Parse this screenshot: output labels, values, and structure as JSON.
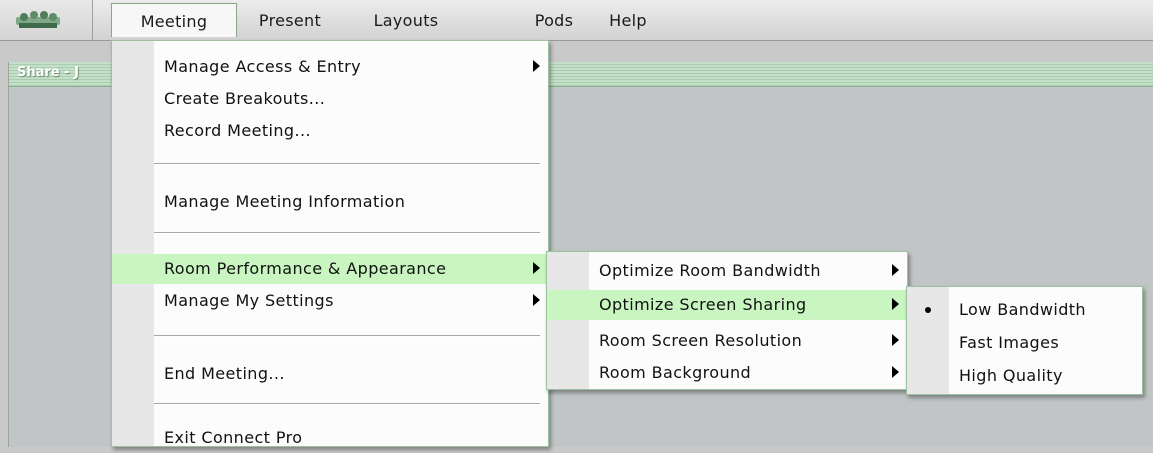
{
  "menubar": {
    "logo_icon": "connect-pro-logo-icon",
    "items": [
      {
        "label": "Meeting"
      },
      {
        "label": "Present"
      },
      {
        "label": "Layouts"
      },
      {
        "label": "Pods"
      },
      {
        "label": "Help"
      }
    ]
  },
  "pod": {
    "title": "Share - J"
  },
  "meeting_menu": {
    "items": [
      {
        "label": "Manage Access & Entry",
        "has_submenu": true
      },
      {
        "label": "Create Breakouts..."
      },
      {
        "label": "Record Meeting..."
      },
      {
        "label": "Manage Meeting Information"
      },
      {
        "label": "Room Performance & Appearance",
        "has_submenu": true,
        "highlighted": true
      },
      {
        "label": "Manage My Settings",
        "has_submenu": true
      },
      {
        "label": "End Meeting..."
      },
      {
        "label": "Exit Connect Pro"
      }
    ]
  },
  "performance_menu": {
    "items": [
      {
        "label": "Optimize Room Bandwidth",
        "has_submenu": true
      },
      {
        "label": "Optimize Screen Sharing",
        "has_submenu": true,
        "highlighted": true
      },
      {
        "label": "Room Screen Resolution",
        "has_submenu": true
      },
      {
        "label": "Room Background",
        "has_submenu": true
      }
    ]
  },
  "screen_sharing_menu": {
    "items": [
      {
        "label": "Low Bandwidth",
        "selected": true
      },
      {
        "label": "Fast Images"
      },
      {
        "label": "High Quality"
      }
    ]
  },
  "colors": {
    "highlight": "#c8f5c0",
    "menu_border": "#9bc19e",
    "pod_title": "#a9cdb0"
  }
}
